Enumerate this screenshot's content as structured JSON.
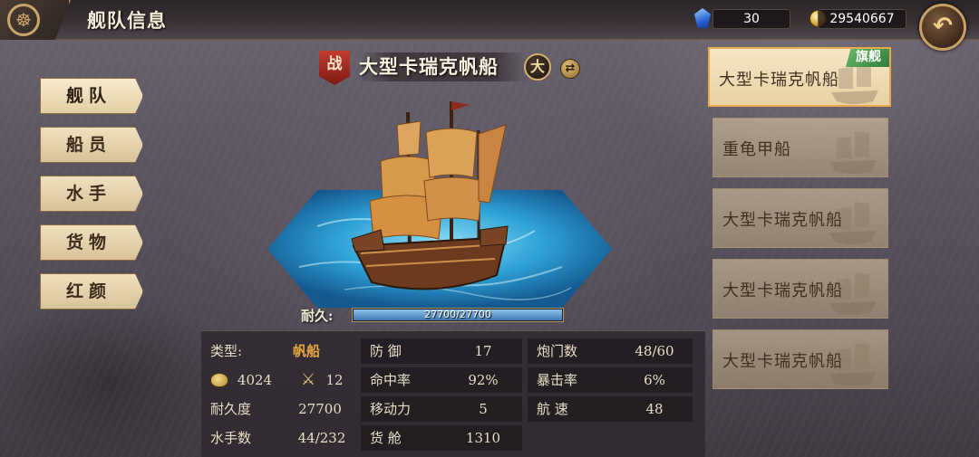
{
  "header": {
    "title": "舰队信息",
    "gems": "30",
    "gold": "29540667"
  },
  "menu": [
    {
      "label": "舰队",
      "active": true
    },
    {
      "label": "船员",
      "active": false
    },
    {
      "label": "水手",
      "active": false
    },
    {
      "label": "货物",
      "active": false
    },
    {
      "label": "红颜",
      "active": false
    }
  ],
  "ship": {
    "battle_badge": "战",
    "name": "大型卡瑞克帆船",
    "size_badge": "大",
    "durability_label": "耐久:",
    "durability_text": "27700/27700",
    "durability_fraction": 1.0
  },
  "stats": {
    "type_label": "类型:",
    "type_value": "帆船",
    "gold_stat": "4024",
    "sword_stat": "12",
    "durability_label": "耐久度",
    "durability_value": "27700",
    "sailors_label": "水手数",
    "sailors_value": "44/232",
    "defense_label": "防 御",
    "defense_value": "17",
    "hit_label": "命中率",
    "hit_value": "92%",
    "mobility_label": "移动力",
    "mobility_value": "5",
    "cargo_label": "货 舱",
    "cargo_value": "1310",
    "gunport_label": "炮门数",
    "gunport_value": "48/60",
    "crit_label": "暴击率",
    "crit_value": "6%",
    "speed_label": "航 速",
    "speed_value": "48"
  },
  "fleet_list": [
    {
      "name": "大型卡瑞克帆船",
      "flag": "旗舰",
      "selected": true
    },
    {
      "name": "重龟甲船",
      "flag": "",
      "selected": false
    },
    {
      "name": "大型卡瑞克帆船",
      "flag": "",
      "selected": false
    },
    {
      "name": "大型卡瑞克帆船",
      "flag": "",
      "selected": false
    },
    {
      "name": "大型卡瑞克帆船",
      "flag": "",
      "selected": false
    }
  ]
}
